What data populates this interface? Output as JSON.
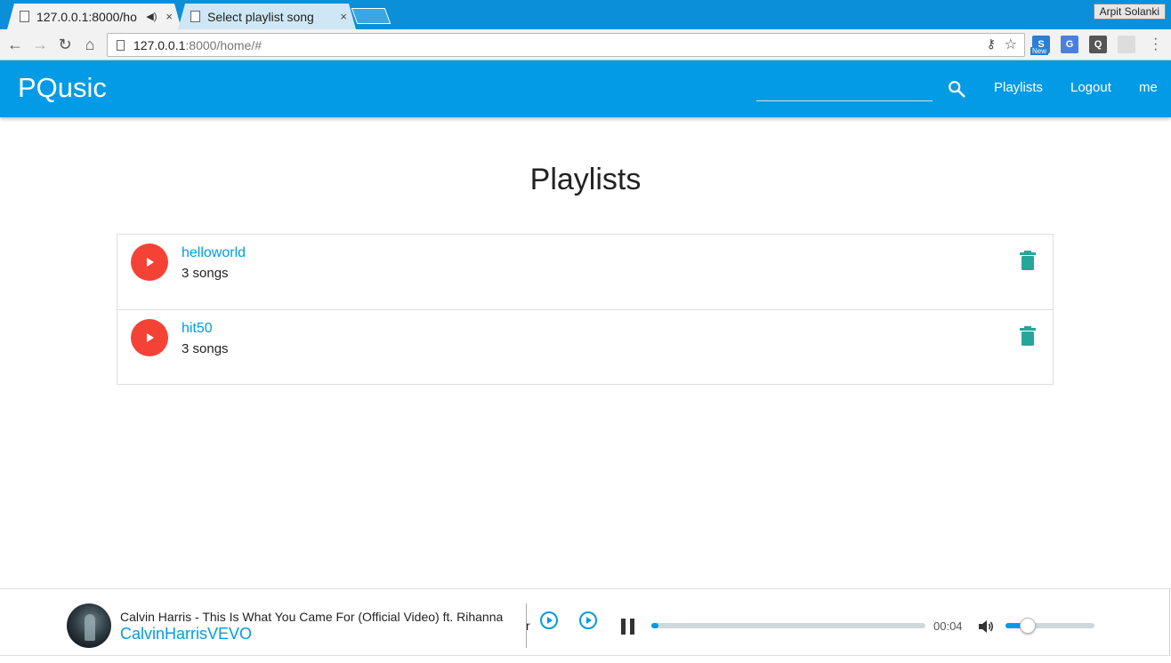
{
  "browser": {
    "tabs": [
      {
        "title": "127.0.0.1:8000/ho",
        "audio_icon": "speaker-icon",
        "close": "×"
      },
      {
        "title": "Select playlist song",
        "close": "×"
      }
    ],
    "profile_name": "Arpit Solanki",
    "url_host": "127.0.0.1",
    "url_path": ":8000/home/#",
    "extensions": [
      {
        "icon": "s-extension-icon",
        "label": "S",
        "badge": "New",
        "color": "#2a7fd4"
      },
      {
        "icon": "translate-extension-icon",
        "label": "G",
        "color": "#4a7fe0"
      },
      {
        "icon": "lightbulb-extension-icon",
        "label": "Q",
        "color": "#555555"
      },
      {
        "icon": "cup-extension-icon",
        "label": "",
        "color": "#dddddd"
      }
    ]
  },
  "app": {
    "brand": "PQusic",
    "search": {
      "value": "",
      "placeholder": ""
    },
    "nav": {
      "playlists": "Playlists",
      "logout": "Logout",
      "me": "me"
    },
    "accent_color": "#039be5"
  },
  "main": {
    "title": "Playlists",
    "playlists": [
      {
        "name": "helloworld",
        "count": "3 songs"
      },
      {
        "name": "hit50",
        "count": "3 songs"
      }
    ],
    "play_color": "#f44336",
    "delete_color": "#26a69a"
  },
  "player": {
    "song_title": "Calvin Harris - This Is What You Came For (Official Video) ft. Rihanna",
    "overflow_char": "r",
    "channel": "CalvinHarrisVEVO",
    "time": "00:04",
    "progress": 0.02,
    "volume": 0.25,
    "state": "playing"
  }
}
